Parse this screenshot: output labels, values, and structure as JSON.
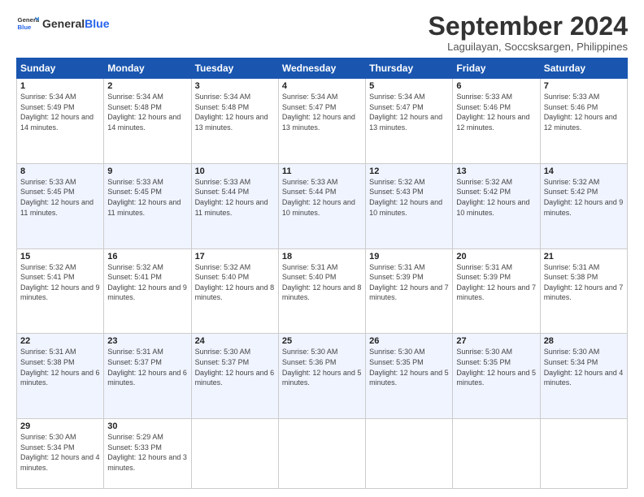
{
  "header": {
    "logo_general": "General",
    "logo_blue": "Blue",
    "month": "September 2024",
    "location": "Laguilayan, Soccsksargen, Philippines"
  },
  "days_of_week": [
    "Sunday",
    "Monday",
    "Tuesday",
    "Wednesday",
    "Thursday",
    "Friday",
    "Saturday"
  ],
  "weeks": [
    [
      {
        "day": "1",
        "sunrise": "Sunrise: 5:34 AM",
        "sunset": "Sunset: 5:49 PM",
        "daylight": "Daylight: 12 hours and 14 minutes."
      },
      {
        "day": "2",
        "sunrise": "Sunrise: 5:34 AM",
        "sunset": "Sunset: 5:48 PM",
        "daylight": "Daylight: 12 hours and 14 minutes."
      },
      {
        "day": "3",
        "sunrise": "Sunrise: 5:34 AM",
        "sunset": "Sunset: 5:48 PM",
        "daylight": "Daylight: 12 hours and 13 minutes."
      },
      {
        "day": "4",
        "sunrise": "Sunrise: 5:34 AM",
        "sunset": "Sunset: 5:47 PM",
        "daylight": "Daylight: 12 hours and 13 minutes."
      },
      {
        "day": "5",
        "sunrise": "Sunrise: 5:34 AM",
        "sunset": "Sunset: 5:47 PM",
        "daylight": "Daylight: 12 hours and 13 minutes."
      },
      {
        "day": "6",
        "sunrise": "Sunrise: 5:33 AM",
        "sunset": "Sunset: 5:46 PM",
        "daylight": "Daylight: 12 hours and 12 minutes."
      },
      {
        "day": "7",
        "sunrise": "Sunrise: 5:33 AM",
        "sunset": "Sunset: 5:46 PM",
        "daylight": "Daylight: 12 hours and 12 minutes."
      }
    ],
    [
      {
        "day": "8",
        "sunrise": "Sunrise: 5:33 AM",
        "sunset": "Sunset: 5:45 PM",
        "daylight": "Daylight: 12 hours and 11 minutes."
      },
      {
        "day": "9",
        "sunrise": "Sunrise: 5:33 AM",
        "sunset": "Sunset: 5:45 PM",
        "daylight": "Daylight: 12 hours and 11 minutes."
      },
      {
        "day": "10",
        "sunrise": "Sunrise: 5:33 AM",
        "sunset": "Sunset: 5:44 PM",
        "daylight": "Daylight: 12 hours and 11 minutes."
      },
      {
        "day": "11",
        "sunrise": "Sunrise: 5:33 AM",
        "sunset": "Sunset: 5:44 PM",
        "daylight": "Daylight: 12 hours and 10 minutes."
      },
      {
        "day": "12",
        "sunrise": "Sunrise: 5:32 AM",
        "sunset": "Sunset: 5:43 PM",
        "daylight": "Daylight: 12 hours and 10 minutes."
      },
      {
        "day": "13",
        "sunrise": "Sunrise: 5:32 AM",
        "sunset": "Sunset: 5:42 PM",
        "daylight": "Daylight: 12 hours and 10 minutes."
      },
      {
        "day": "14",
        "sunrise": "Sunrise: 5:32 AM",
        "sunset": "Sunset: 5:42 PM",
        "daylight": "Daylight: 12 hours and 9 minutes."
      }
    ],
    [
      {
        "day": "15",
        "sunrise": "Sunrise: 5:32 AM",
        "sunset": "Sunset: 5:41 PM",
        "daylight": "Daylight: 12 hours and 9 minutes."
      },
      {
        "day": "16",
        "sunrise": "Sunrise: 5:32 AM",
        "sunset": "Sunset: 5:41 PM",
        "daylight": "Daylight: 12 hours and 9 minutes."
      },
      {
        "day": "17",
        "sunrise": "Sunrise: 5:32 AM",
        "sunset": "Sunset: 5:40 PM",
        "daylight": "Daylight: 12 hours and 8 minutes."
      },
      {
        "day": "18",
        "sunrise": "Sunrise: 5:31 AM",
        "sunset": "Sunset: 5:40 PM",
        "daylight": "Daylight: 12 hours and 8 minutes."
      },
      {
        "day": "19",
        "sunrise": "Sunrise: 5:31 AM",
        "sunset": "Sunset: 5:39 PM",
        "daylight": "Daylight: 12 hours and 7 minutes."
      },
      {
        "day": "20",
        "sunrise": "Sunrise: 5:31 AM",
        "sunset": "Sunset: 5:39 PM",
        "daylight": "Daylight: 12 hours and 7 minutes."
      },
      {
        "day": "21",
        "sunrise": "Sunrise: 5:31 AM",
        "sunset": "Sunset: 5:38 PM",
        "daylight": "Daylight: 12 hours and 7 minutes."
      }
    ],
    [
      {
        "day": "22",
        "sunrise": "Sunrise: 5:31 AM",
        "sunset": "Sunset: 5:38 PM",
        "daylight": "Daylight: 12 hours and 6 minutes."
      },
      {
        "day": "23",
        "sunrise": "Sunrise: 5:31 AM",
        "sunset": "Sunset: 5:37 PM",
        "daylight": "Daylight: 12 hours and 6 minutes."
      },
      {
        "day": "24",
        "sunrise": "Sunrise: 5:30 AM",
        "sunset": "Sunset: 5:37 PM",
        "daylight": "Daylight: 12 hours and 6 minutes."
      },
      {
        "day": "25",
        "sunrise": "Sunrise: 5:30 AM",
        "sunset": "Sunset: 5:36 PM",
        "daylight": "Daylight: 12 hours and 5 minutes."
      },
      {
        "day": "26",
        "sunrise": "Sunrise: 5:30 AM",
        "sunset": "Sunset: 5:35 PM",
        "daylight": "Daylight: 12 hours and 5 minutes."
      },
      {
        "day": "27",
        "sunrise": "Sunrise: 5:30 AM",
        "sunset": "Sunset: 5:35 PM",
        "daylight": "Daylight: 12 hours and 5 minutes."
      },
      {
        "day": "28",
        "sunrise": "Sunrise: 5:30 AM",
        "sunset": "Sunset: 5:34 PM",
        "daylight": "Daylight: 12 hours and 4 minutes."
      }
    ],
    [
      {
        "day": "29",
        "sunrise": "Sunrise: 5:30 AM",
        "sunset": "Sunset: 5:34 PM",
        "daylight": "Daylight: 12 hours and 4 minutes."
      },
      {
        "day": "30",
        "sunrise": "Sunrise: 5:29 AM",
        "sunset": "Sunset: 5:33 PM",
        "daylight": "Daylight: 12 hours and 3 minutes."
      },
      {
        "day": "",
        "sunrise": "",
        "sunset": "",
        "daylight": ""
      },
      {
        "day": "",
        "sunrise": "",
        "sunset": "",
        "daylight": ""
      },
      {
        "day": "",
        "sunrise": "",
        "sunset": "",
        "daylight": ""
      },
      {
        "day": "",
        "sunrise": "",
        "sunset": "",
        "daylight": ""
      },
      {
        "day": "",
        "sunrise": "",
        "sunset": "",
        "daylight": ""
      }
    ]
  ]
}
